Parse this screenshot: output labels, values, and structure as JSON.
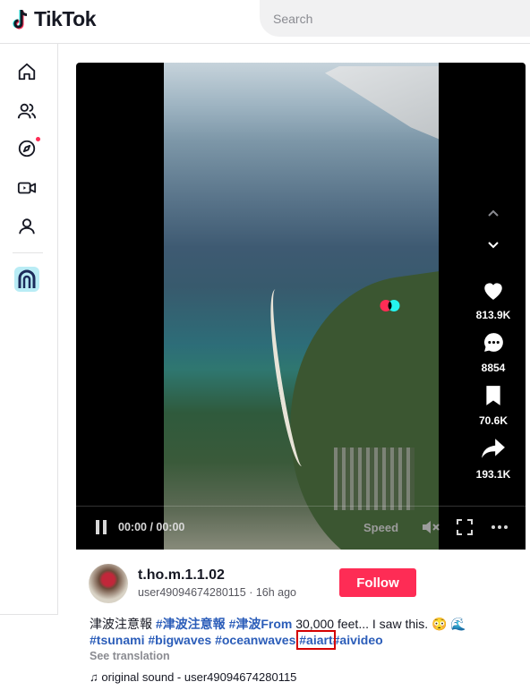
{
  "header": {
    "logo_text": "TikTok",
    "search_placeholder": "Search"
  },
  "sidebar": {
    "items": [
      {
        "icon": "home-icon"
      },
      {
        "icon": "following-icon"
      },
      {
        "icon": "explore-icon",
        "badge": true
      },
      {
        "icon": "live-icon"
      },
      {
        "icon": "profile-icon"
      },
      {
        "icon": "app-icon"
      }
    ]
  },
  "player": {
    "time": "00:00 / 00:00",
    "speed_label": "Speed",
    "actions": {
      "likes": "813.9K",
      "comments": "8854",
      "saves": "70.6K",
      "shares": "193.1K"
    }
  },
  "post": {
    "display_name": "t.ho.m.1.1.02",
    "handle": "user49094674280115",
    "age": "16h ago",
    "meta": "user49094674280115 · 16h ago",
    "follow_label": "Follow",
    "caption_prefix": "津波注意報 ",
    "caption_tag1": "#津波注意報",
    "caption_tag2": "#津波From",
    "caption_text": " 30,000 feet... I saw this.",
    "caption_emojis": "😳 🌊",
    "caption_tags_line2": [
      "#tsunami",
      "#bigwaves",
      "#oceanwaves",
      "#aiart",
      "#aivideo"
    ],
    "see_translation": "See translation",
    "music": "original sound - user49094674280115"
  },
  "colors": {
    "accent": "#fe2c55",
    "hashtag": "#2b5db9",
    "highlight": "#d40000"
  }
}
